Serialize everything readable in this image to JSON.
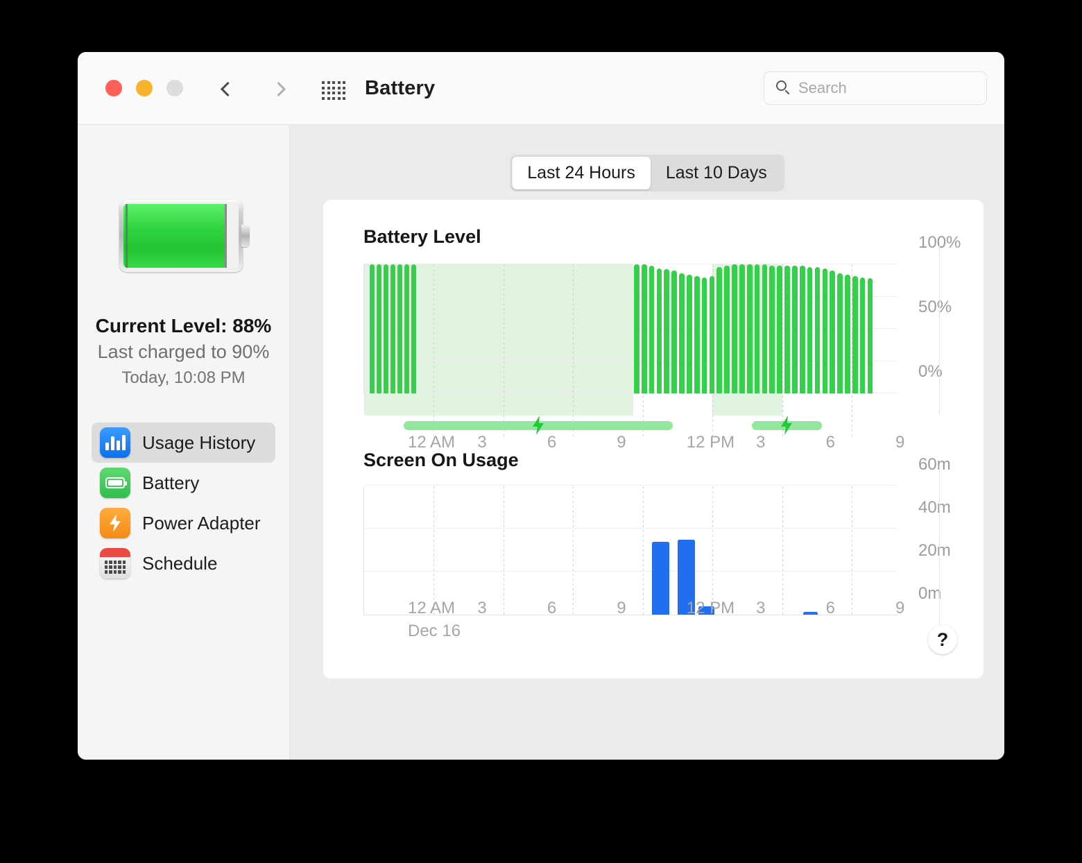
{
  "window": {
    "title": "Battery",
    "traffic_lights": [
      "close-red",
      "minimize-yellow",
      "zoom-gray"
    ],
    "nav": {
      "back_icon": "chevron-left-icon",
      "forward_icon": "chevron-right-icon",
      "grid_icon": "grid-apps-icon"
    }
  },
  "search": {
    "placeholder": "Search",
    "value": "",
    "icon": "search-icon"
  },
  "sidebar": {
    "battery_icon": "battery-full-icon",
    "current_level": "Current Level: 88%",
    "last_charged": "Last charged to 90%",
    "last_charged_time": "Today, 10:08 PM",
    "battery_fill_percent": 88,
    "items": [
      {
        "label": "Usage History",
        "icon": "bar-chart-icon",
        "color": "#0a72f0",
        "selected": true
      },
      {
        "label": "Battery",
        "icon": "battery-icon",
        "color": "#2fbe4b",
        "selected": false
      },
      {
        "label": "Power Adapter",
        "icon": "bolt-icon",
        "color": "#f58a14",
        "selected": false
      },
      {
        "label": "Schedule",
        "icon": "calendar-icon",
        "color": "#ea4a43",
        "selected": false
      }
    ]
  },
  "segmented_control": {
    "options": [
      "Last 24 Hours",
      "Last 10 Days"
    ],
    "selected": "Last 24 Hours"
  },
  "help_button": {
    "label": "?"
  },
  "colors": {
    "battery_bar": "#34d04a",
    "charge_band": "#dff3df",
    "charge_bar": "#93e79c",
    "screen_bar": "#1f6ff0",
    "accent_blue": "#0a72f0"
  },
  "chart_data": [
    {
      "type": "bar",
      "title": "Battery Level",
      "xlabel": "",
      "ylabel": "",
      "ylim": [
        0,
        100
      ],
      "yticks": [
        0,
        50,
        100
      ],
      "ytick_labels": [
        "0%",
        "50%",
        "100%"
      ],
      "gridlines": [
        0,
        25,
        50,
        75,
        100
      ],
      "xtick_labels": [
        "12 AM",
        "3",
        "6",
        "9",
        "12 PM",
        "3",
        "6",
        "9"
      ],
      "xtick_hours": [
        0,
        3,
        6,
        9,
        12,
        15,
        18,
        21
      ],
      "x_range_hours": [
        0,
        23
      ],
      "bar_color": "#34d04a",
      "categories": [
        "0:00",
        "0:20",
        "0:40",
        "1:00",
        "1:20",
        "1:40",
        "2:00",
        "11:40",
        "12:00",
        "12:20",
        "12:40",
        "13:00",
        "13:20",
        "13:40",
        "14:00",
        "14:20",
        "14:40",
        "15:00",
        "15:20",
        "15:40",
        "16:00",
        "16:20",
        "16:40",
        "17:00",
        "17:20",
        "17:40",
        "18:00",
        "18:20",
        "18:40",
        "19:00",
        "19:20",
        "19:40",
        "20:00",
        "20:20",
        "20:40",
        "21:00",
        "21:20",
        "21:40",
        "22:00"
      ],
      "values": [
        100,
        100,
        100,
        100,
        100,
        100,
        100,
        100,
        100,
        99,
        97,
        96,
        95,
        93,
        92,
        91,
        90,
        91,
        98,
        99,
        100,
        100,
        100,
        100,
        100,
        99,
        99,
        99,
        99,
        99,
        98,
        98,
        97,
        95,
        93,
        92,
        91,
        90,
        89
      ],
      "charging_periods": [
        {
          "start_hour": 0,
          "end_hour": 11.6,
          "label": "charging",
          "icon": "bolt-icon"
        },
        {
          "start_hour": 15.0,
          "end_hour": 18.0,
          "label": "charging",
          "icon": "bolt-icon"
        }
      ]
    },
    {
      "type": "bar",
      "title": "Screen On Usage",
      "xlabel": "Dec 16",
      "ylabel": "",
      "ylim": [
        0,
        60
      ],
      "yticks": [
        0,
        20,
        40,
        60
      ],
      "ytick_labels": [
        "0m",
        "20m",
        "40m",
        "60m"
      ],
      "gridlines": [
        0,
        20,
        40,
        60
      ],
      "xtick_labels": [
        "12 AM",
        "3",
        "6",
        "9",
        "12 PM",
        "3",
        "6",
        "9"
      ],
      "xtick_hours": [
        0,
        3,
        6,
        9,
        12,
        15,
        18,
        21
      ],
      "x_range_hours": [
        0,
        23
      ],
      "bar_color": "#1f6ff0",
      "categories": [
        "12:30 PM",
        "1:30 PM",
        "2:30 PM",
        "7:00 PM"
      ],
      "category_hours": [
        12.4,
        13.5,
        14.4,
        18.9
      ],
      "values": [
        34,
        35,
        4,
        1
      ]
    }
  ]
}
